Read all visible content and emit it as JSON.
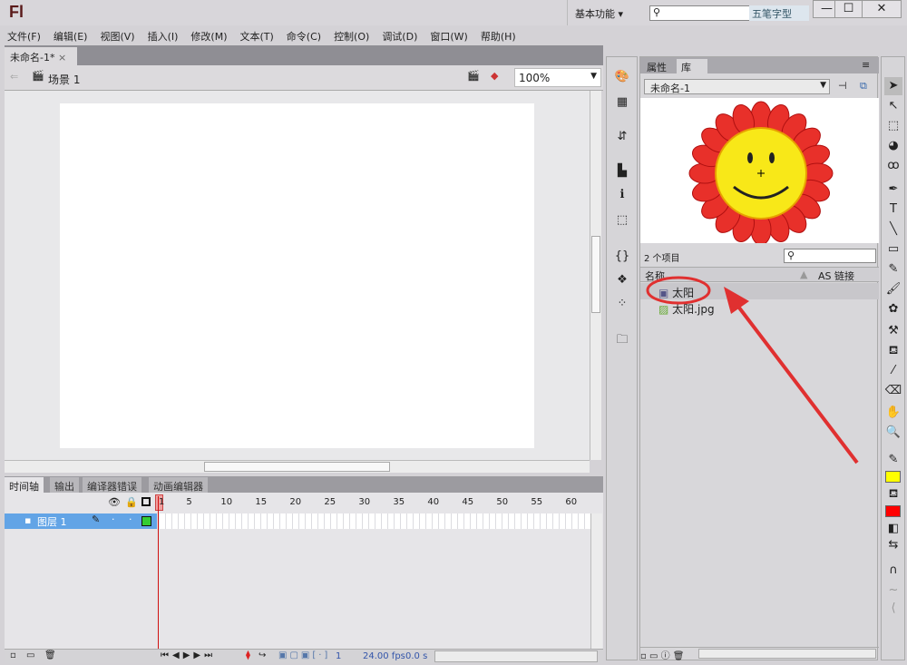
{
  "app": {
    "logo": "Fl",
    "workspace": "基本功能 ▾",
    "ime": "五笔字型",
    "minimize": "—",
    "maximize": "☐",
    "close": "✕"
  },
  "menu": [
    "文件(F)",
    "编辑(E)",
    "视图(V)",
    "插入(I)",
    "修改(M)",
    "文本(T)",
    "命令(C)",
    "控制(O)",
    "调试(D)",
    "窗口(W)",
    "帮助(H)"
  ],
  "document": {
    "tab": "未命名-1*",
    "tab_close": "×",
    "scene": "场景 1",
    "zoom": "100%"
  },
  "timeline": {
    "tabs": [
      "时间轴",
      "输出",
      "编译器错误",
      "动画编辑器"
    ],
    "layer": "图层 1",
    "frame_numbers": [
      "1",
      "5",
      "10",
      "15",
      "20",
      "25",
      "30",
      "35",
      "40",
      "45",
      "50",
      "55",
      "60"
    ],
    "current_frame": "1",
    "fps": "24.00 fps",
    "time": "0.0 s"
  },
  "library": {
    "tabs": [
      "属性",
      "库"
    ],
    "document": "未命名-1",
    "count": "2 个项目",
    "col_name": "名称",
    "col_linkage": "AS 链接",
    "items": [
      {
        "name": "太阳",
        "icon": "graphic-symbol-icon"
      },
      {
        "name": "太阳.jpg",
        "icon": "bitmap-icon"
      }
    ]
  },
  "colors": {
    "stroke": "#ffff00",
    "fill": "#ff0000",
    "annotation": "#e03030"
  }
}
